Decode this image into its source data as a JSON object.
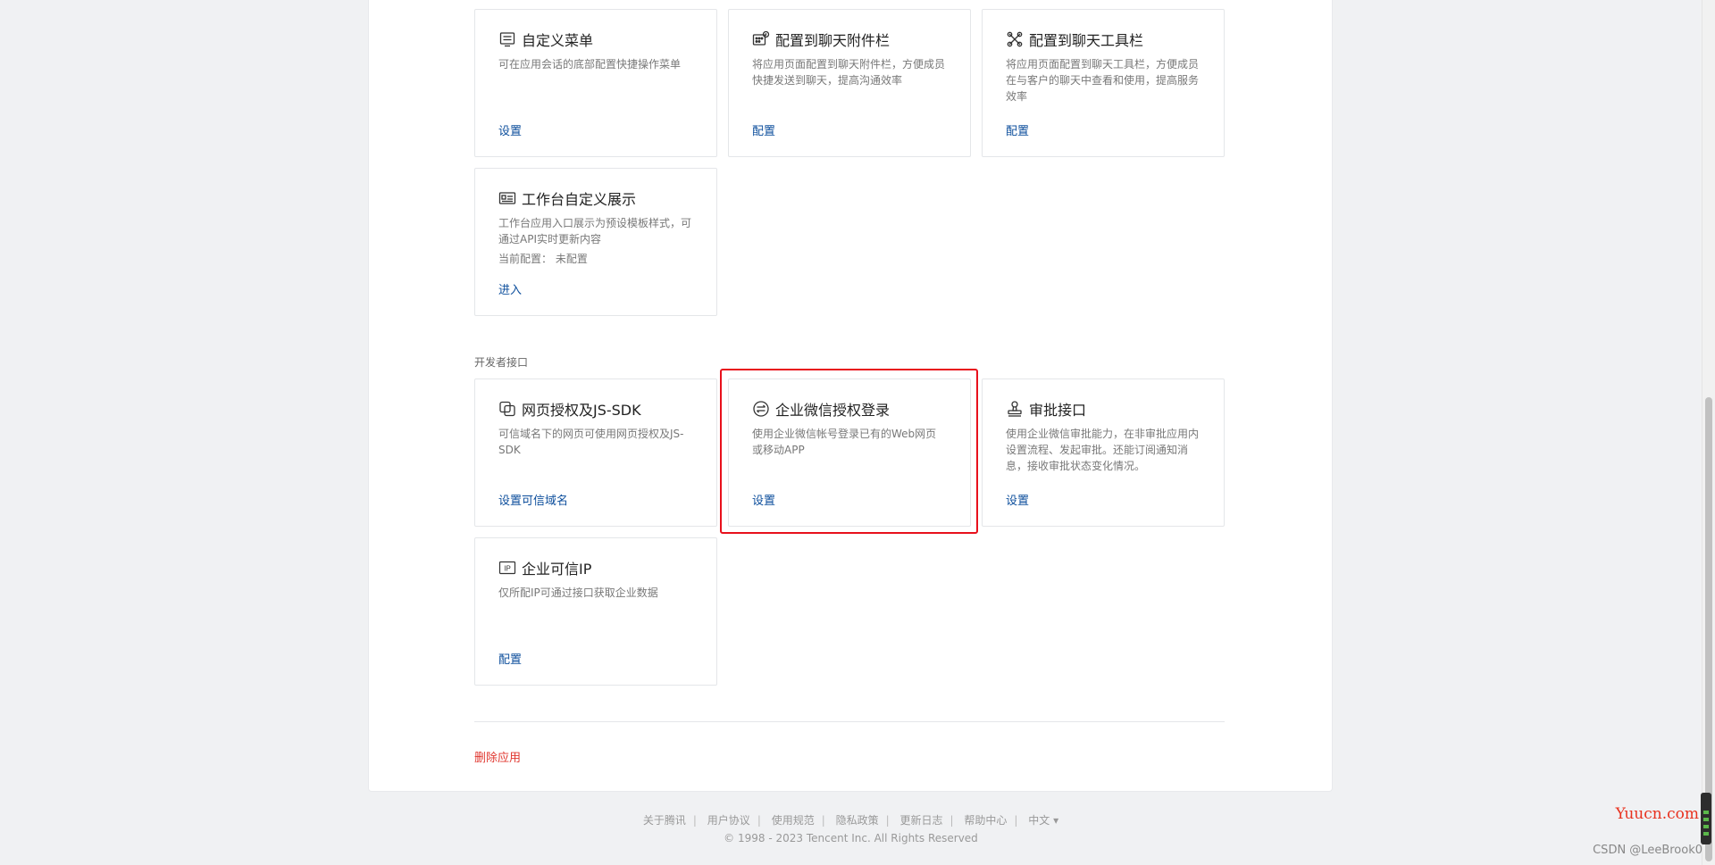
{
  "cards_top": [
    {
      "name": "custom-menu",
      "title": "自定义菜单",
      "desc": "可在应用会话的底部配置快捷操作菜单",
      "action": "设置"
    },
    {
      "name": "chat-attachment",
      "title": "配置到聊天附件栏",
      "desc": "将应用页面配置到聊天附件栏，方便成员快捷发送到聊天，提高沟通效率",
      "action": "配置"
    },
    {
      "name": "chat-toolbar",
      "title": "配置到聊天工具栏",
      "desc": "将应用页面配置到聊天工具栏，方便成员在与客户的聊天中查看和使用，提高服务效率",
      "action": "配置"
    },
    {
      "name": "workbench-display",
      "title": "工作台自定义展示",
      "desc": "工作台应用入口展示为预设模板样式，可通过API实时更新内容",
      "meta": "当前配置： 未配置",
      "action": "进入"
    }
  ],
  "section_label": "开发者接口",
  "cards_dev": [
    {
      "name": "web-auth-jssdk",
      "title": "网页授权及JS-SDK",
      "desc": "可信域名下的网页可使用网页授权及JS-SDK",
      "action": "设置可信域名"
    },
    {
      "name": "wecom-auth-login",
      "title": "企业微信授权登录",
      "desc": "使用企业微信帐号登录已有的Web网页或移动APP",
      "action": "设置"
    },
    {
      "name": "approval-api",
      "title": "审批接口",
      "desc": "使用企业微信审批能力，在非审批应用内设置流程、发起审批。还能订阅通知消息，接收审批状态变化情况。",
      "action": "设置"
    },
    {
      "name": "trusted-ip",
      "title": "企业可信IP",
      "desc": "仅所配IP可通过接口获取企业数据",
      "action": "配置"
    }
  ],
  "delete_label": "删除应用",
  "footer": {
    "links": [
      "关于腾讯",
      "用户协议",
      "使用规范",
      "隐私政策",
      "更新日志",
      "帮助中心",
      "中文 ▾"
    ],
    "copyright": "© 1998 - 2023 Tencent Inc. All Rights Reserved"
  },
  "watermark": "Yuucn.com",
  "csdn": "CSDN @LeeBrook0"
}
